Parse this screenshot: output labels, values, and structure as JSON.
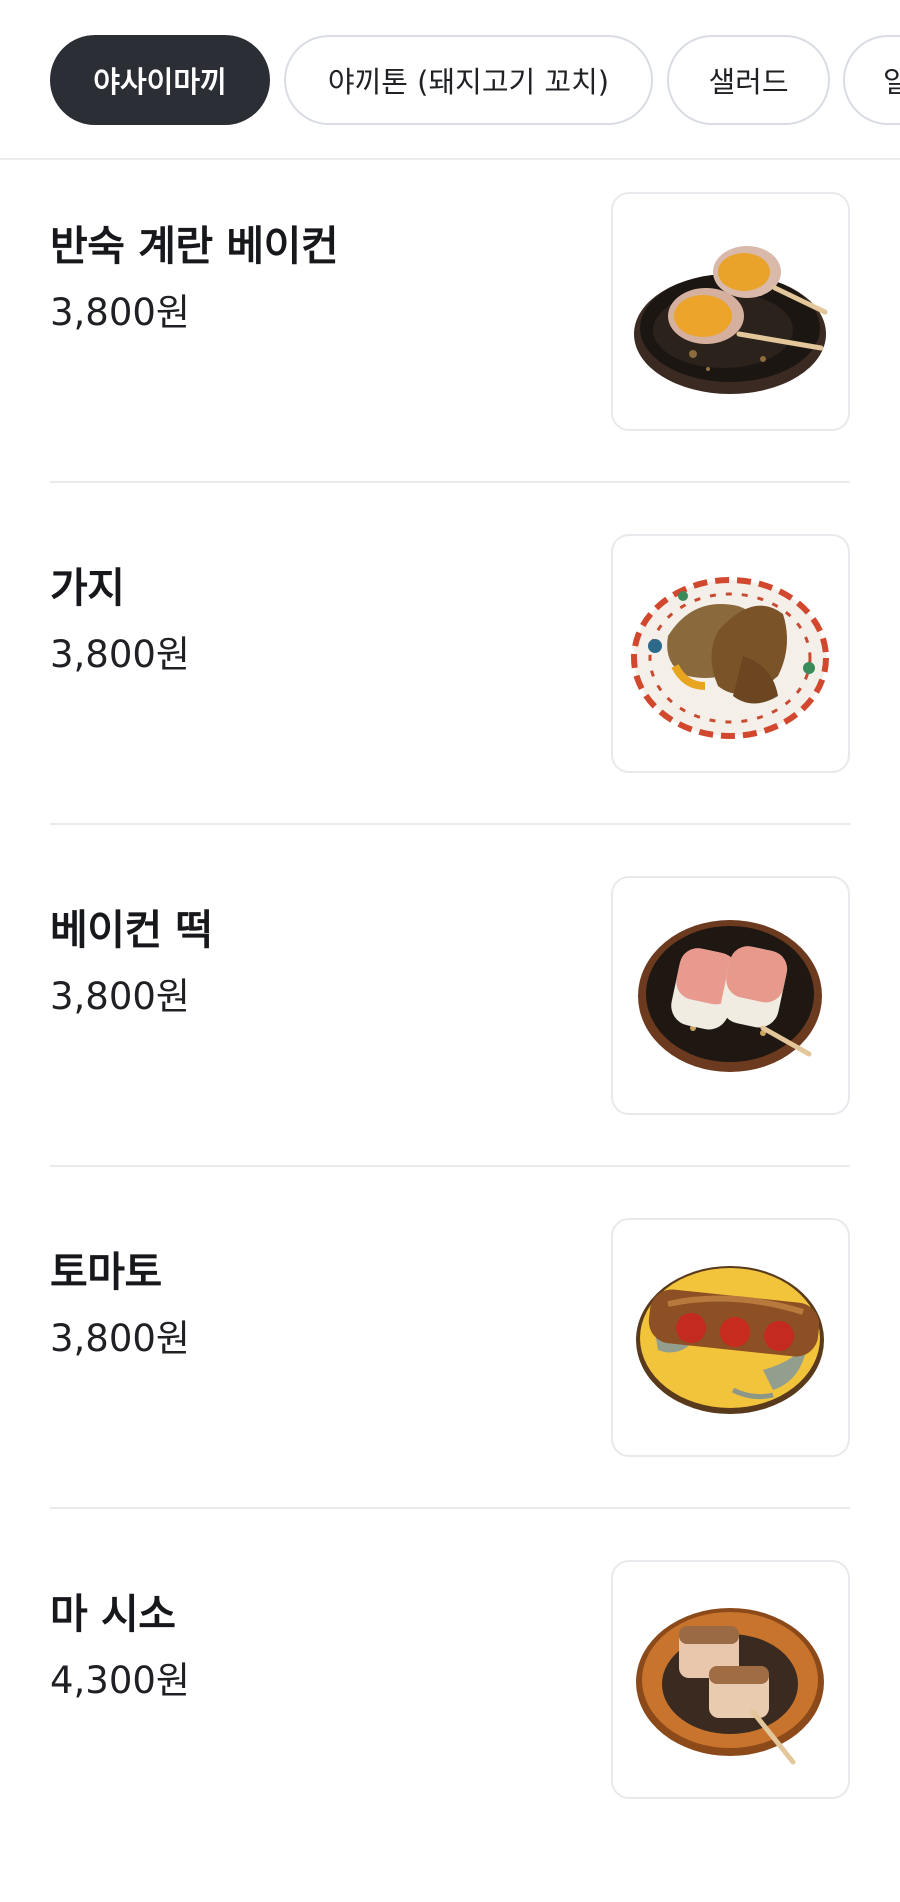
{
  "categories": [
    {
      "label": "야사이마끼",
      "active": true
    },
    {
      "label": "야끼톤 (돼지고기 꼬치)",
      "active": false
    },
    {
      "label": "샐러드",
      "active": false
    },
    {
      "label": "일",
      "active": false
    }
  ],
  "menu": {
    "items": [
      {
        "name": "반숙 계란 베이컨",
        "price": "3,800원",
        "image": "soft-boiled-egg-bacon-skewer-photo"
      },
      {
        "name": "가지",
        "price": "3,800원",
        "image": "eggplant-skewer-photo"
      },
      {
        "name": "베이컨 떡",
        "price": "3,800원",
        "image": "bacon-rice-cake-skewer-photo"
      },
      {
        "name": "토마토",
        "price": "3,800원",
        "image": "tomato-bacon-skewer-photo"
      },
      {
        "name": "마 시소",
        "price": "4,300원",
        "image": "yam-shiso-skewer-photo"
      }
    ]
  },
  "colors": {
    "active_chip_bg": "#2b2e34",
    "chip_border": "#d9dde3",
    "divider": "#e9eaed",
    "text": "#17181b"
  }
}
